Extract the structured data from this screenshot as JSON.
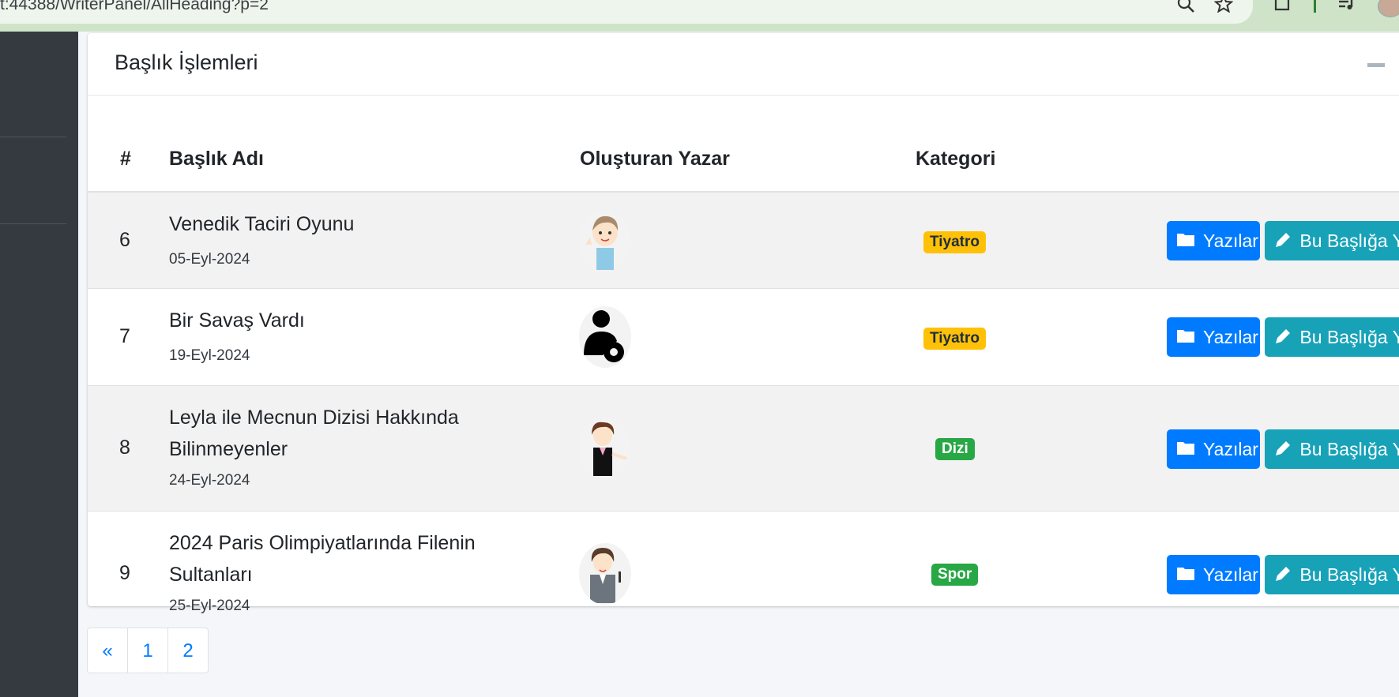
{
  "browser": {
    "url": "t:44388/WriterPanel/AllHeading?p=2"
  },
  "card": {
    "title": "Başlık İşlemleri"
  },
  "table": {
    "headers": {
      "num": "#",
      "title": "Başlık Adı",
      "author": "Oluşturan Yazar",
      "category": "Kategori"
    },
    "rows": [
      {
        "num": "6",
        "title": "Venedik Taciri Oyunu",
        "date": "05-Eyl-2024",
        "category": "Tiyatro",
        "category_color": "#ffc107",
        "author_icon": "cartoon-boy-avatar"
      },
      {
        "num": "7",
        "title": "Bir Savaş Vardı",
        "date": "19-Eyl-2024",
        "category": "Tiyatro",
        "category_color": "#ffc107",
        "author_icon": "user-gear-avatar"
      },
      {
        "num": "8",
        "title": "Leyla ile Mecnun Dizisi Hakkında Bilinmeyenler",
        "date": "24-Eyl-2024",
        "category": "Dizi",
        "category_color": "#28a745",
        "author_icon": "cartoon-woman-avatar"
      },
      {
        "num": "9",
        "title": "2024 Paris Olimpiyatlarında Filenin Sultanları",
        "date": "25-Eyl-2024",
        "category": "Spor",
        "category_color": "#28a745",
        "author_icon": "cartoon-businesswoman-avatar"
      }
    ],
    "actions": {
      "posts_label": "Yazılar",
      "write_label": "Bu Başlığa Yaz"
    }
  },
  "pagination": {
    "prev": "«",
    "pages": [
      "1",
      "2"
    ]
  },
  "colors": {
    "primary": "#007bff",
    "info": "#17a2b8",
    "sidebar": "#343a40"
  }
}
